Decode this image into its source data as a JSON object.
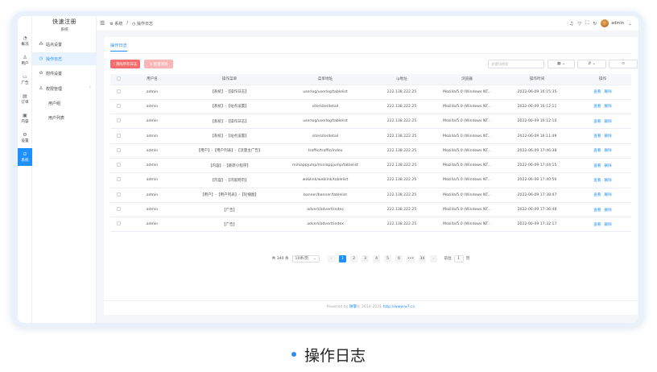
{
  "iconbar": {
    "items": [
      {
        "icon": "gauge-icon",
        "glyph": "◔",
        "label": "概况"
      },
      {
        "icon": "user-icon",
        "glyph": "♙",
        "label": "用户"
      },
      {
        "icon": "ad-icon",
        "glyph": "▭",
        "label": "广告"
      },
      {
        "icon": "order-icon",
        "glyph": "▤",
        "label": "订单"
      },
      {
        "icon": "content-icon",
        "glyph": "▣",
        "label": "内容"
      },
      {
        "icon": "settings-icon",
        "glyph": "⚙",
        "label": "设置"
      },
      {
        "icon": "system-icon",
        "glyph": "⊙",
        "label": "系统"
      }
    ]
  },
  "sidebar": {
    "brand": "快速注册",
    "subtitle": "系统",
    "items": [
      {
        "label": "站点设置",
        "glyph": "⁂"
      },
      {
        "label": "操作日志",
        "glyph": "◷"
      },
      {
        "label": "附件设置",
        "glyph": "⊘"
      },
      {
        "label": "权限管理",
        "glyph": "♙",
        "chevron": "⌃"
      }
    ],
    "sub_items": [
      "用户组",
      "用户列表"
    ]
  },
  "topbar": {
    "menu_glyph": "☰",
    "crumb_1": "⚙ 系统",
    "crumb_sep": "/",
    "crumb_2": "◷ 操作日志",
    "icons": [
      "♫",
      "▽",
      "⛶",
      "↻"
    ],
    "username": "admin",
    "user_chevron": "⌄"
  },
  "card": {
    "tab": "操作日志",
    "btn_clear_all": "! 清除所有日志",
    "btn_clear_selected": "⊘ 批量清除",
    "search_placeholder": "关键词搜索",
    "tool_1": "▦ ⌄",
    "tool_2": "⇵ ⌄",
    "tool_3": "⊙"
  },
  "table": {
    "columns": [
      "用户名",
      "操作菜单",
      "菜单地址",
      "ip地址",
      "浏览器",
      "操作时间",
      "操作"
    ],
    "op_view": "查看",
    "op_delete": "删除",
    "rows": [
      {
        "user": "admin",
        "menu": "【系统】-【操作日志】",
        "url": "userlog/userlog/tablelist",
        "ip": "222.138.222.25",
        "browser": "Mozilla/5.0 (Windows NT...",
        "time": "2022-06-09 16:15:35"
      },
      {
        "user": "admin",
        "menu": "【系统】-【站点设置】",
        "url": "site/site/detail",
        "ip": "222.138.222.25",
        "browser": "Mozilla/5.0 (Windows NT...",
        "time": "2022-06-09 16:12:11"
      },
      {
        "user": "admin",
        "menu": "【系统】-【操作日志】",
        "url": "userlog/userlog/tablelist",
        "ip": "222.138.222.25",
        "browser": "Mozilla/5.0 (Windows NT...",
        "time": "2022-06-09 16:12:10"
      },
      {
        "user": "admin",
        "menu": "【系统】-【站点设置】",
        "url": "site/site/detail",
        "ip": "222.138.222.25",
        "browser": "Mozilla/5.0 (Windows NT...",
        "time": "2022-06-09 16:11:49"
      },
      {
        "user": "admin",
        "menu": "【用户】-【用户列表】-【流量主广告】",
        "url": "traffic/traffic/index",
        "ip": "222.138.222.25",
        "browser": "Mozilla/5.0 (Windows NT...",
        "time": "2022-06-09 17:46:38"
      },
      {
        "user": "admin",
        "menu": "【内容】-【跳转小程序】",
        "url": "miniappjump/miniappjump/tablelist",
        "ip": "222.138.222.25",
        "browser": "Mozilla/5.0 (Windows NT...",
        "time": "2022-06-09 17:44:15"
      },
      {
        "user": "admin",
        "menu": "【内容】-【内嵌网页】",
        "url": "weblink/weblink/tablelist",
        "ip": "222.138.222.25",
        "browser": "Mozilla/5.0 (Windows NT...",
        "time": "2022-06-09 17:40:56"
      },
      {
        "user": "admin",
        "menu": "【用户】-【用户列表】-【轮播图】",
        "url": "banner/banner/tablelist",
        "ip": "222.138.222.25",
        "browser": "Mozilla/5.0 (Windows NT...",
        "time": "2022-06-09 17:38:47"
      },
      {
        "user": "admin",
        "menu": "【广告】",
        "url": "advert/advert/index",
        "ip": "222.138.222.25",
        "browser": "Mozilla/5.0 (Windows NT...",
        "time": "2022-06-09 17:36:48"
      },
      {
        "user": "admin",
        "menu": "【广告】",
        "url": "advert/advert/index",
        "ip": "222.138.222.25",
        "browser": "Mozilla/5.0 (Windows NT...",
        "time": "2022-06-09 17:32:17"
      }
    ]
  },
  "pager": {
    "total": "共 340 条",
    "page_size": "10条/页",
    "page_size_chevron": "⌄",
    "prev": "‹",
    "pages": [
      "1",
      "2",
      "3",
      "4",
      "5",
      "6",
      "•••",
      "34"
    ],
    "active_page": "1",
    "next": "›",
    "goto_label": "前往",
    "goto_value": "1",
    "goto_suffix": "页"
  },
  "footer": {
    "prefix": "Powered by ",
    "brand": "微擎",
    "suffix": "© 2014-2021 ",
    "link": "http://www.w7.cc"
  },
  "caption": "操作日志",
  "colors": {
    "accent": "#1e90ff",
    "danger": "#f56c6c",
    "danger_light": "#fab6b6"
  }
}
